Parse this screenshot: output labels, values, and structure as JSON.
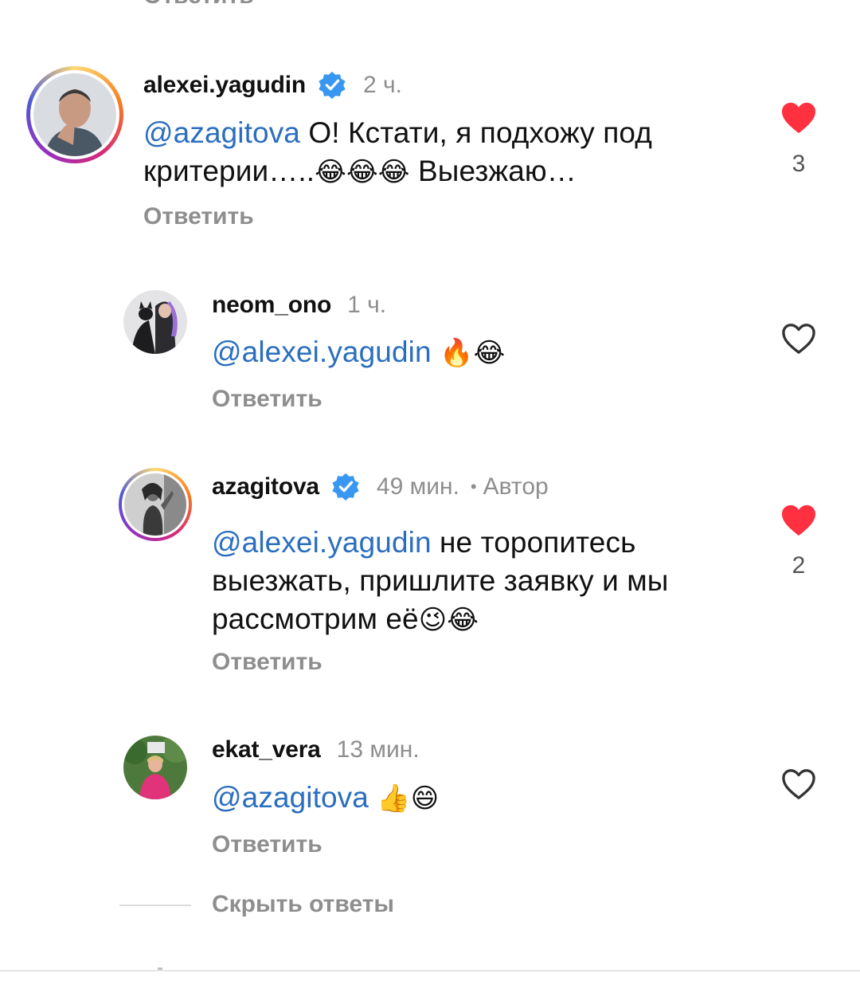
{
  "top_cut_label": "Ответить",
  "colors": {
    "mention": "#2a6ebf",
    "like_active": "#ff3040",
    "muted_text": "#8e8e8e",
    "verified_badge": "#3897f0"
  },
  "comments": [
    {
      "username": "alexei.yagudin",
      "verified": true,
      "time": "2 ч.",
      "mention": "@azagitova",
      "text_line1": " О! Кстати, я подхожу под",
      "text_line2": "критерии…..",
      "emoji2": "😂😂😂",
      "text_line2_tail": " Выезжаю…",
      "reply_label": "Ответить",
      "liked": true,
      "like_count": "3",
      "avatar_icon": "avatar-photo"
    },
    {
      "username": "neom_ono",
      "verified": false,
      "time": "1 ч.",
      "mention": "@alexei.yagudin",
      "emoji": "🔥😂",
      "reply_label": "Ответить",
      "liked": false,
      "avatar_icon": "avatar-photo"
    },
    {
      "username": "azagitova",
      "verified": true,
      "time": "49 мин.",
      "dot": "•",
      "author_label": "Автор",
      "mention": "@alexei.yagudin",
      "text_line1": " не торопитесь",
      "text_line2": "выезжать, пришлите заявку и мы",
      "text_line3": "рассмотрим её",
      "emoji3": "😉😂",
      "reply_label": "Ответить",
      "liked": true,
      "like_count": "2",
      "avatar_icon": "avatar-photo"
    },
    {
      "username": "ekat_vera",
      "verified": false,
      "time": "13 мин.",
      "mention": "@azagitova",
      "emoji": "👍😄",
      "reply_label": "Ответить",
      "liked": false,
      "avatar_icon": "avatar-photo"
    }
  ],
  "hide_replies_label": "Скрыть ответы"
}
